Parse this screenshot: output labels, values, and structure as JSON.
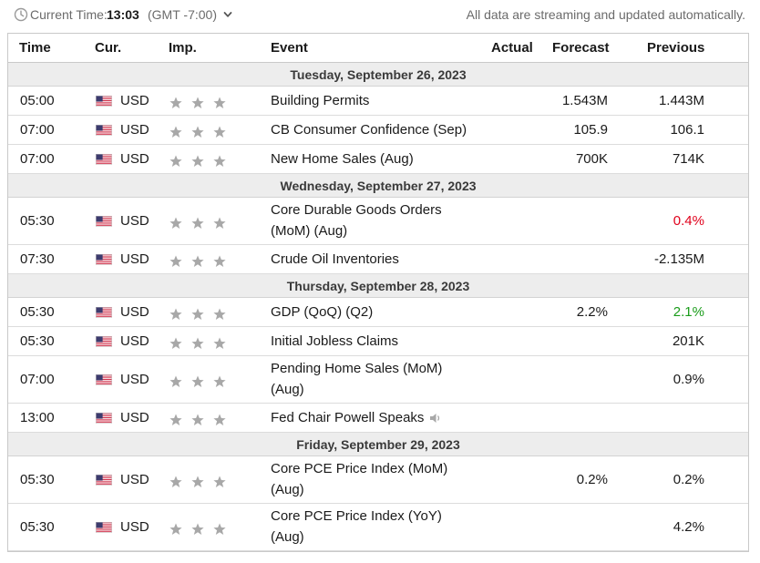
{
  "topbar": {
    "clock_icon": "clock-icon",
    "current_time_label": "Current Time:",
    "current_time_value": "13:03",
    "timezone": "(GMT -7:00)",
    "timezone_chevron": "chevron-down-icon",
    "stream_note": "All data are streaming and updated automatically."
  },
  "table": {
    "headers": {
      "time": "Time",
      "cur": "Cur.",
      "imp": "Imp.",
      "event": "Event",
      "actual": "Actual",
      "forecast": "Forecast",
      "previous": "Previous"
    },
    "days": [
      {
        "date": "Tuesday, September 26, 2023",
        "events": [
          {
            "time": "05:00",
            "flag": "us-flag-icon",
            "cur": "USD",
            "importance": 3,
            "event": "Building Permits",
            "actual": "",
            "forecast": "1.543M",
            "previous": "1.443M"
          },
          {
            "time": "07:00",
            "flag": "us-flag-icon",
            "cur": "USD",
            "importance": 3,
            "event": "CB Consumer Confidence (Sep)",
            "actual": "",
            "forecast": "105.9",
            "previous": "106.1"
          },
          {
            "time": "07:00",
            "flag": "us-flag-icon",
            "cur": "USD",
            "importance": 3,
            "event": "New Home Sales (Aug)",
            "actual": "",
            "forecast": "700K",
            "previous": "714K"
          }
        ]
      },
      {
        "date": "Wednesday, September 27, 2023",
        "events": [
          {
            "time": "05:30",
            "flag": "us-flag-icon",
            "cur": "USD",
            "importance": 3,
            "event_line1": "Core Durable Goods Orders",
            "event_line2": "(MoM) (Aug)",
            "actual": "",
            "forecast": "",
            "previous": "0.4%",
            "previous_color": "#e0001b"
          },
          {
            "time": "07:30",
            "flag": "us-flag-icon",
            "cur": "USD",
            "importance": 3,
            "event": "Crude Oil Inventories",
            "actual": "",
            "forecast": "",
            "previous": "-2.135M"
          }
        ]
      },
      {
        "date": "Thursday, September 28, 2023",
        "events": [
          {
            "time": "05:30",
            "flag": "us-flag-icon",
            "cur": "USD",
            "importance": 3,
            "event": "GDP (QoQ) (Q2)",
            "actual": "",
            "forecast": "2.2%",
            "previous": "2.1%",
            "previous_color": "#1a9c1a"
          },
          {
            "time": "05:30",
            "flag": "us-flag-icon",
            "cur": "USD",
            "importance": 3,
            "event": "Initial Jobless Claims",
            "actual": "",
            "forecast": "",
            "previous": "201K"
          },
          {
            "time": "07:00",
            "flag": "us-flag-icon",
            "cur": "USD",
            "importance": 3,
            "event_line1": "Pending Home Sales (MoM)",
            "event_line2": "(Aug)",
            "actual": "",
            "forecast": "",
            "previous": "0.9%"
          },
          {
            "time": "13:00",
            "flag": "us-flag-icon",
            "cur": "USD",
            "importance": 3,
            "event": "Fed Chair Powell Speaks",
            "event_icon": "speaker-icon",
            "actual": "",
            "forecast": "",
            "previous": ""
          }
        ]
      },
      {
        "date": "Friday, September 29, 2023",
        "events": [
          {
            "time": "05:30",
            "flag": "us-flag-icon",
            "cur": "USD",
            "importance": 3,
            "event_line1": "Core PCE Price Index (MoM)",
            "event_line2": "(Aug)",
            "actual": "",
            "forecast": "0.2%",
            "previous": "0.2%"
          },
          {
            "time": "05:30",
            "flag": "us-flag-icon",
            "cur": "USD",
            "importance": 3,
            "event_line1": "Core PCE Price Index (YoY)",
            "event_line2": "(Aug)",
            "actual": "",
            "forecast": "",
            "previous": "4.2%"
          }
        ]
      }
    ]
  },
  "colors": {
    "negative": "#e0001b",
    "positive": "#1a9c1a",
    "star_grey": "#a8a8a8",
    "day_row_bg": "#ededed"
  }
}
